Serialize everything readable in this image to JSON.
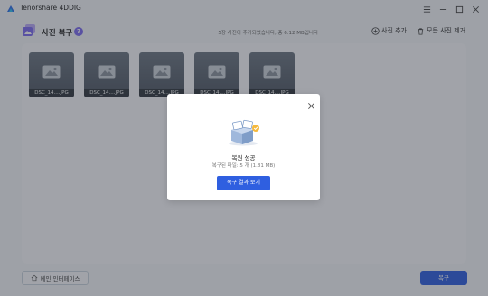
{
  "app": {
    "title": "Tenorshare 4DDIG"
  },
  "header": {
    "title": "사진 복구",
    "help": "?",
    "summary": "5장 사진이 추가되었습니다, 총 6.12 MB입니다",
    "add_photo": "사진 추가",
    "delete_all": "모든 사진 제거"
  },
  "thumbnails": [
    {
      "name": "DSC_14....JPG"
    },
    {
      "name": "DSC_14....JPG"
    },
    {
      "name": "DSC_14....JPG"
    },
    {
      "name": "DSC_14....JPG"
    },
    {
      "name": "DSC_14....JPG"
    }
  ],
  "footer": {
    "main_interface": "메인 인터페이스",
    "recover": "복구"
  },
  "modal": {
    "title": "복원 성공",
    "subtitle": "복구된 파일: 5 개 (1.81 MB)",
    "button": "복구 결과 보기"
  },
  "colors": {
    "accent": "#2f5fe0",
    "help_badge": "#7d6cf0"
  }
}
